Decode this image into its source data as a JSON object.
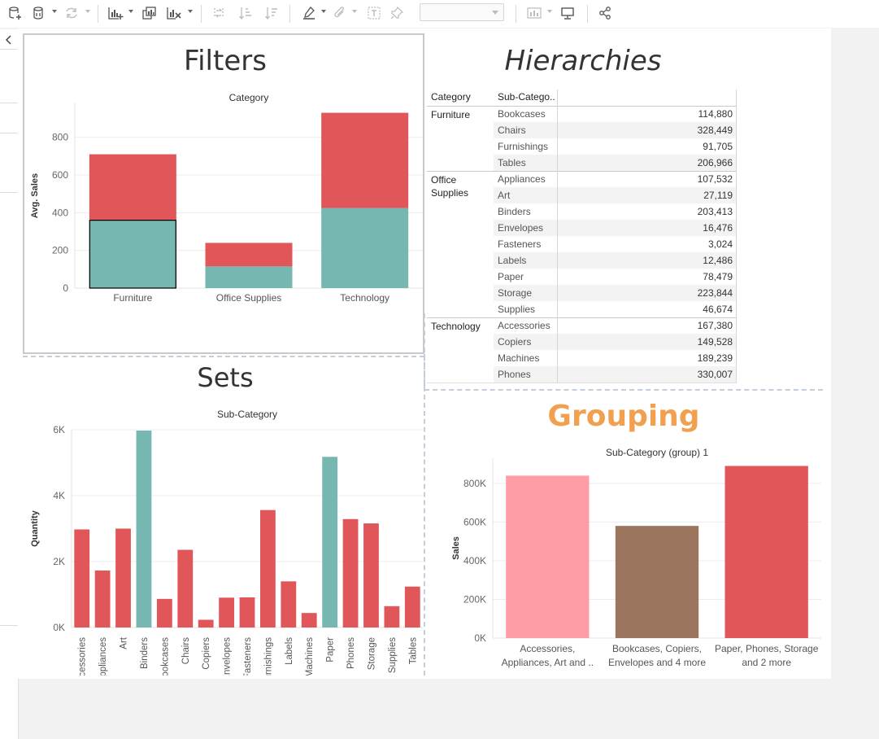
{
  "toolbar": {
    "icons": [
      "new-data-source-icon",
      "pause-data-icon",
      "refresh-icon",
      "new-worksheet-icon",
      "duplicate-sheet-icon",
      "clear-sheet-icon",
      "swap-axes-icon",
      "sort-ascending-icon",
      "sort-descending-icon",
      "highlight-icon",
      "attach-icon",
      "text-label-icon",
      "pin-icon",
      "show-me-icon",
      "presentation-icon",
      "share-icon"
    ],
    "dropdown_value": ""
  },
  "dashboard": {
    "filters_title": "Filters",
    "hierarchies_title": "Hierarchies",
    "sets_title": "Sets",
    "grouping_title": "Grouping",
    "grouping_title_color": "#f0a04f"
  },
  "colors": {
    "red": "#e15759",
    "teal": "#76b7b2",
    "pink": "#ff9da7",
    "brown": "#9c755f"
  },
  "chart_data": [
    {
      "id": "filters",
      "type": "bar",
      "stacked": true,
      "header": "Category",
      "ylabel": "Avg. Sales",
      "categories": [
        "Furniture",
        "Office Supplies",
        "Technology"
      ],
      "series": [
        {
          "color": "teal",
          "values": [
            360,
            115,
            425
          ]
        },
        {
          "color": "red",
          "values": [
            350,
            125,
            505
          ]
        }
      ],
      "ylim": [
        0,
        980
      ],
      "yticks": [
        0,
        200,
        400,
        600,
        800
      ],
      "ytick_labels": [
        "0",
        "200",
        "400",
        "600",
        "800"
      ],
      "selected_bar": "Furniture",
      "grid": true
    },
    {
      "id": "hierarchies",
      "type": "table",
      "columns": [
        "Category",
        "Sub-Catego.."
      ],
      "groups": [
        {
          "category": "Furniture",
          "rows": [
            {
              "sub": "Bookcases",
              "value": "114,880"
            },
            {
              "sub": "Chairs",
              "value": "328,449"
            },
            {
              "sub": "Furnishings",
              "value": "91,705"
            },
            {
              "sub": "Tables",
              "value": "206,966"
            }
          ]
        },
        {
          "category": "Office Supplies",
          "rows": [
            {
              "sub": "Appliances",
              "value": "107,532"
            },
            {
              "sub": "Art",
              "value": "27,119"
            },
            {
              "sub": "Binders",
              "value": "203,413"
            },
            {
              "sub": "Envelopes",
              "value": "16,476"
            },
            {
              "sub": "Fasteners",
              "value": "3,024"
            },
            {
              "sub": "Labels",
              "value": "12,486"
            },
            {
              "sub": "Paper",
              "value": "78,479"
            },
            {
              "sub": "Storage",
              "value": "223,844"
            },
            {
              "sub": "Supplies",
              "value": "46,674"
            }
          ]
        },
        {
          "category": "Technology",
          "rows": [
            {
              "sub": "Accessories",
              "value": "167,380"
            },
            {
              "sub": "Copiers",
              "value": "149,528"
            },
            {
              "sub": "Machines",
              "value": "189,239"
            },
            {
              "sub": "Phones",
              "value": "330,007"
            }
          ]
        }
      ]
    },
    {
      "id": "sets",
      "type": "bar",
      "header": "Sub-Category",
      "ylabel": "Quantity",
      "categories": [
        "Accessories",
        "Appliances",
        "Art",
        "Binders",
        "Bookcases",
        "Chairs",
        "Copiers",
        "Envelopes",
        "Fasteners",
        "Furnishings",
        "Labels",
        "Machines",
        "Paper",
        "Phones",
        "Storage",
        "Supplies",
        "Tables"
      ],
      "values": [
        2976,
        1729,
        3000,
        5974,
        868,
        2356,
        234,
        906,
        914,
        3563,
        1400,
        440,
        5178,
        3289,
        3158,
        647,
        1241
      ],
      "colors": [
        "red",
        "red",
        "red",
        "teal",
        "red",
        "red",
        "red",
        "red",
        "red",
        "red",
        "red",
        "red",
        "teal",
        "red",
        "red",
        "red",
        "red"
      ],
      "ylim": [
        0,
        6000
      ],
      "yticks": [
        0,
        2000,
        4000,
        6000
      ],
      "ytick_labels": [
        "0K",
        "2K",
        "4K",
        "6K"
      ],
      "grid": true
    },
    {
      "id": "grouping",
      "type": "bar",
      "header": "Sub-Category (group) 1",
      "ylabel": "Sales",
      "categories": [
        [
          "Accessories,",
          "Appliances, Art and .."
        ],
        [
          "Bookcases, Copiers,",
          "Envelopes and 4 more"
        ],
        [
          "Paper, Phones, Storage",
          "and 2 more"
        ]
      ],
      "values": [
        840000,
        580000,
        890000
      ],
      "colors": [
        "pink",
        "brown",
        "red"
      ],
      "ylim": [
        0,
        930000
      ],
      "yticks": [
        0,
        200000,
        400000,
        600000,
        800000
      ],
      "ytick_labels": [
        "0K",
        "200K",
        "400K",
        "600K",
        "800K"
      ],
      "grid": true
    }
  ]
}
